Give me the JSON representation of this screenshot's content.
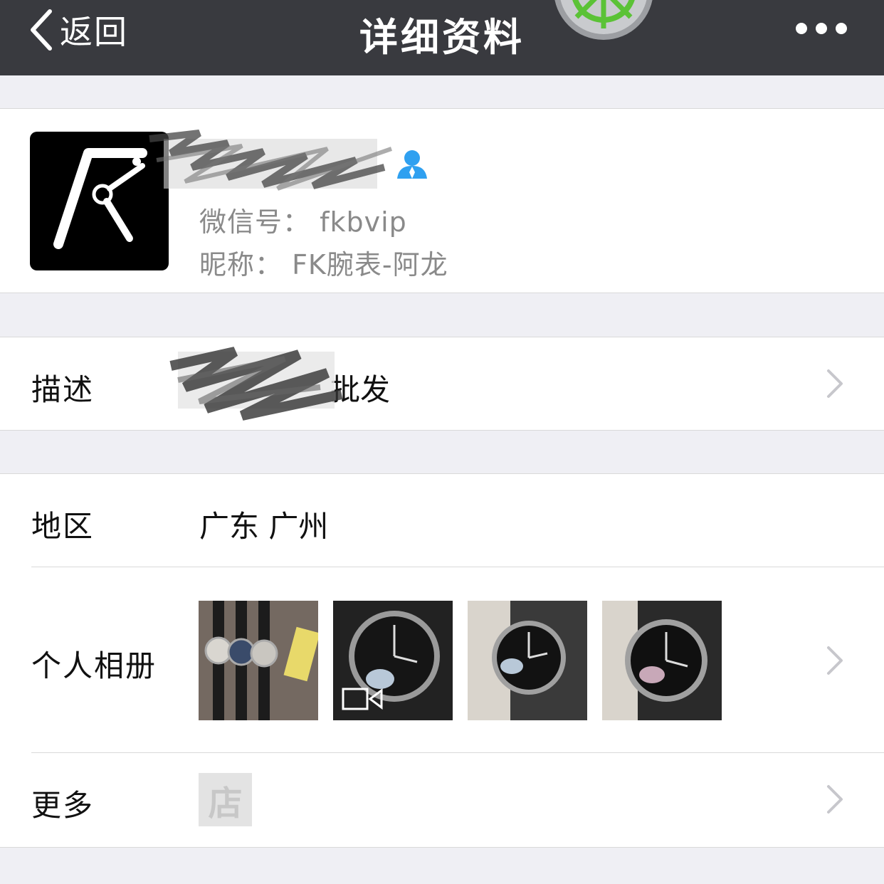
{
  "navbar": {
    "back_label": "返回",
    "title": "详细资料"
  },
  "profile": {
    "wechat_id": "微信号： fkbvip",
    "nickname": "昵称： FK腕表-阿龙"
  },
  "description": {
    "label": "描述",
    "value": "批发"
  },
  "region": {
    "label": "地区",
    "value": "广东 广州"
  },
  "album": {
    "label": "个人相册",
    "thumbnails": [
      "watch-group",
      "watch-video",
      "watch-hand",
      "watch-angle"
    ]
  },
  "more": {
    "label": "更多",
    "shop_icon_text": "店"
  },
  "colors": {
    "navbar": "#393a3f",
    "page_bg": "#efeff4",
    "contact_icon": "#2fa0f0",
    "wheel_green": "#5bc236"
  }
}
